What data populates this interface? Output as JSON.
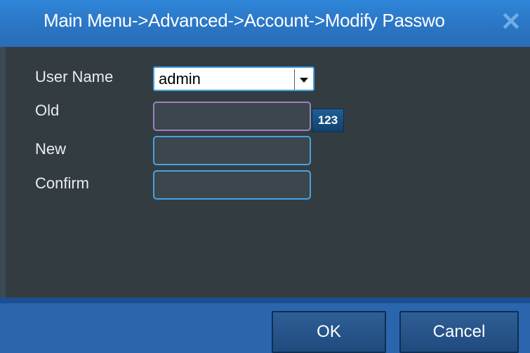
{
  "window": {
    "title": "Main Menu->Advanced->Account->Modify Passwo",
    "close_symbol": "✕"
  },
  "form": {
    "user_name_label": "User Name",
    "user_name_value": "admin",
    "old_label": "Old",
    "new_label": "New",
    "confirm_label": "Confirm",
    "old_value": "",
    "new_value": "",
    "confirm_value": "",
    "input_mode_label": "123"
  },
  "footer": {
    "ok_label": "OK",
    "cancel_label": "Cancel"
  },
  "colors": {
    "titlebar": "#2b78c8",
    "field_border": "#46a3e4",
    "focused_field_border": "#9a82c0",
    "footer": "#2b65ae"
  },
  "icons": {
    "close": "close-icon",
    "dropdown": "chevron-down-icon"
  }
}
